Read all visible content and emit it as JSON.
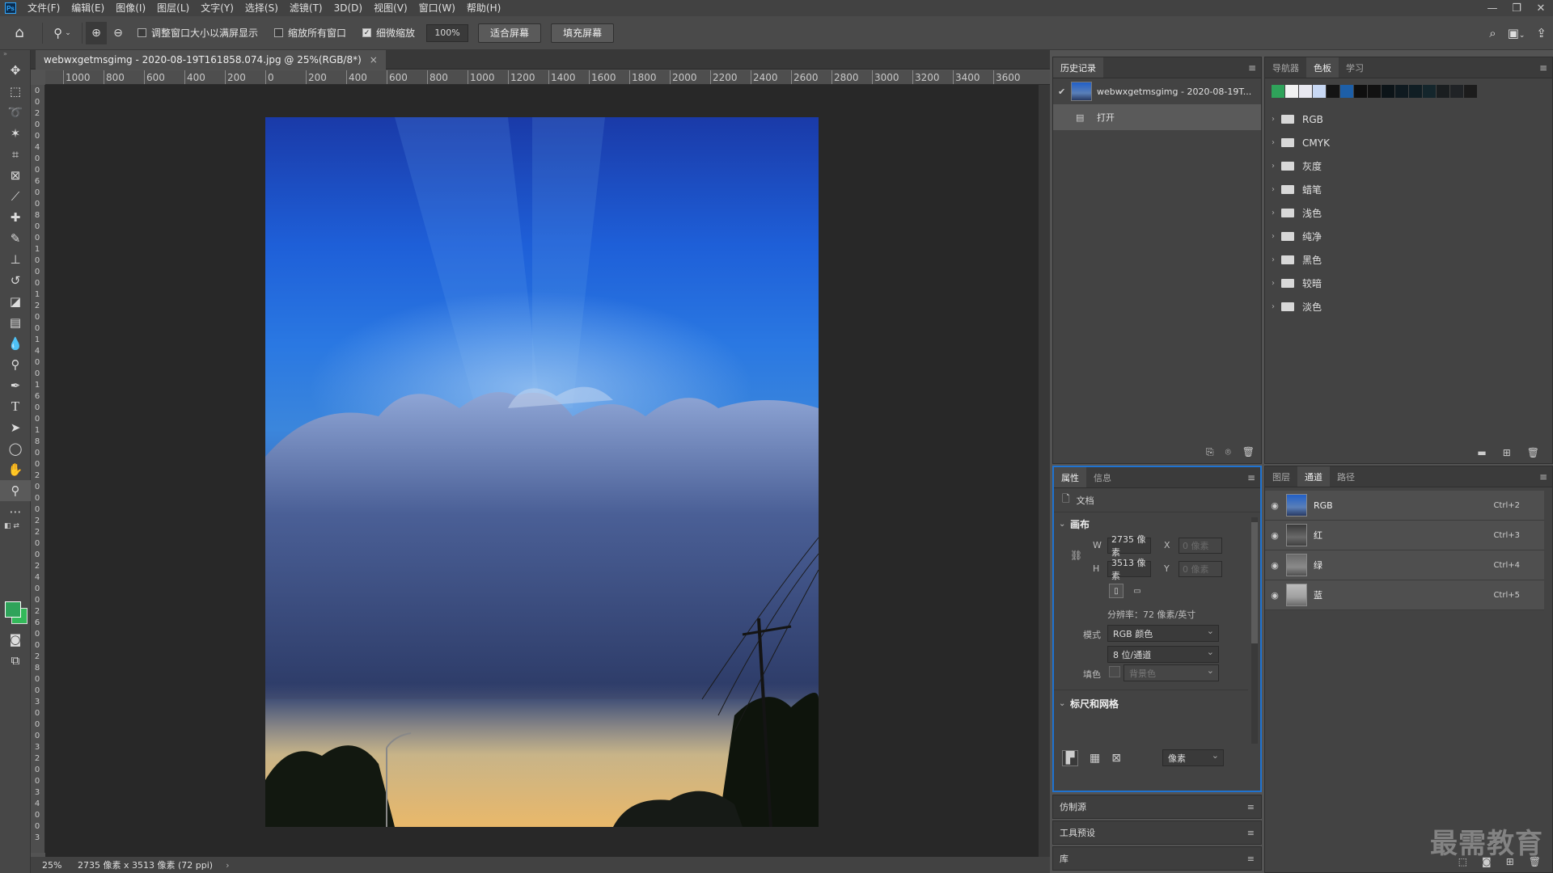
{
  "menubar": {
    "logo": "Ps",
    "items": [
      "文件(F)",
      "编辑(E)",
      "图像(I)",
      "图层(L)",
      "文字(Y)",
      "选择(S)",
      "滤镜(T)",
      "3D(D)",
      "视图(V)",
      "窗口(W)",
      "帮助(H)"
    ]
  },
  "options": {
    "resize_windows": "调整窗口大小以满屏显示",
    "resize_checked": false,
    "zoom_all": "缩放所有窗口",
    "zoom_all_checked": false,
    "scrubby": "细微缩放",
    "scrubby_checked": true,
    "zoom_pct": "100%",
    "fit_screen": "适合屏幕",
    "fill_screen": "填充屏幕"
  },
  "document": {
    "tab_title": "webwxgetmsgimg - 2020-08-19T161858.074.jpg @ 25%(RGB/8*)",
    "close": "×"
  },
  "ruler": {
    "h_ticks": [
      "1000",
      "800",
      "600",
      "400",
      "200",
      "0",
      "200",
      "400",
      "600",
      "800",
      "1000",
      "1200",
      "1400",
      "1600",
      "1800",
      "2000",
      "2200",
      "2400",
      "2600",
      "2800",
      "3000",
      "3200",
      "3400",
      "3600"
    ],
    "v_ticks": [
      "0",
      "0",
      "2",
      "0",
      "0",
      "4",
      "0",
      "0",
      "6",
      "0",
      "0",
      "8",
      "0",
      "0",
      "1",
      "0",
      "0",
      "0",
      "1",
      "2",
      "0",
      "0",
      "1",
      "4",
      "0",
      "0",
      "1",
      "6",
      "0",
      "0",
      "1",
      "8",
      "0",
      "0",
      "2",
      "0",
      "0",
      "0",
      "2",
      "2",
      "0",
      "0",
      "2",
      "4",
      "0",
      "0",
      "2",
      "6",
      "0",
      "0",
      "2",
      "8",
      "0",
      "0",
      "3",
      "0",
      "0",
      "0",
      "3",
      "2",
      "0",
      "0",
      "3",
      "4",
      "0",
      "0",
      "3"
    ]
  },
  "status": {
    "zoom": "25%",
    "dims": "2735 像素 x 3513 像素 (72 ppi)",
    "arrow": "›"
  },
  "colors": {
    "foreground": "#2fa35a",
    "background": "#33b95a"
  },
  "history": {
    "tab": "历史记录",
    "snapshot": "webwxgetmsgimg - 2020-08-19T...",
    "steps": [
      "打开"
    ]
  },
  "swatches": {
    "tabs": [
      "导航器",
      "色板",
      "学习"
    ],
    "active_tab": "色板",
    "recent": [
      "#2fa35a",
      "#f2f2f2",
      "#e8e8f0",
      "#c8d8f4",
      "#141414",
      "#1d5fa8",
      "#0f0f0f",
      "#121212",
      "#0c1418",
      "#0f1a20",
      "#101e24",
      "#14262c",
      "#1a1e20",
      "#202326",
      "#1c1c1c"
    ],
    "groups": [
      "RGB",
      "CMYK",
      "灰度",
      "蜡笔",
      "浅色",
      "纯净",
      "黑色",
      "较暗",
      "淡色"
    ]
  },
  "properties": {
    "tabs": [
      "属性",
      "信息"
    ],
    "doc_label": "文档",
    "canvas_title": "画布",
    "w_label": "W",
    "w_value": "2735 像素",
    "h_label": "H",
    "h_value": "3513 像素",
    "x_label": "X",
    "x_value": "0 像素",
    "y_label": "Y",
    "y_value": "0 像素",
    "resolution": "分辨率：72 像素/英寸",
    "mode_label": "模式",
    "mode_value": "RGB 颜色",
    "depth_value": "8 位/通道",
    "fill_label": "填色",
    "fill_value": "背景色",
    "rulers_title": "标尺和网格",
    "unit_value": "像素"
  },
  "channels": {
    "tabs": [
      "图层",
      "通道",
      "路径"
    ],
    "active_tab": "通道",
    "rows": [
      {
        "name": "RGB",
        "shortcut": "Ctrl+2"
      },
      {
        "name": "红",
        "shortcut": "Ctrl+3"
      },
      {
        "name": "绿",
        "shortcut": "Ctrl+4"
      },
      {
        "name": "蓝",
        "shortcut": "Ctrl+5"
      }
    ]
  },
  "collapsed": {
    "clone_source": "仿制源",
    "tool_presets": "工具预设",
    "library": "库"
  },
  "watermark": "最需教育"
}
